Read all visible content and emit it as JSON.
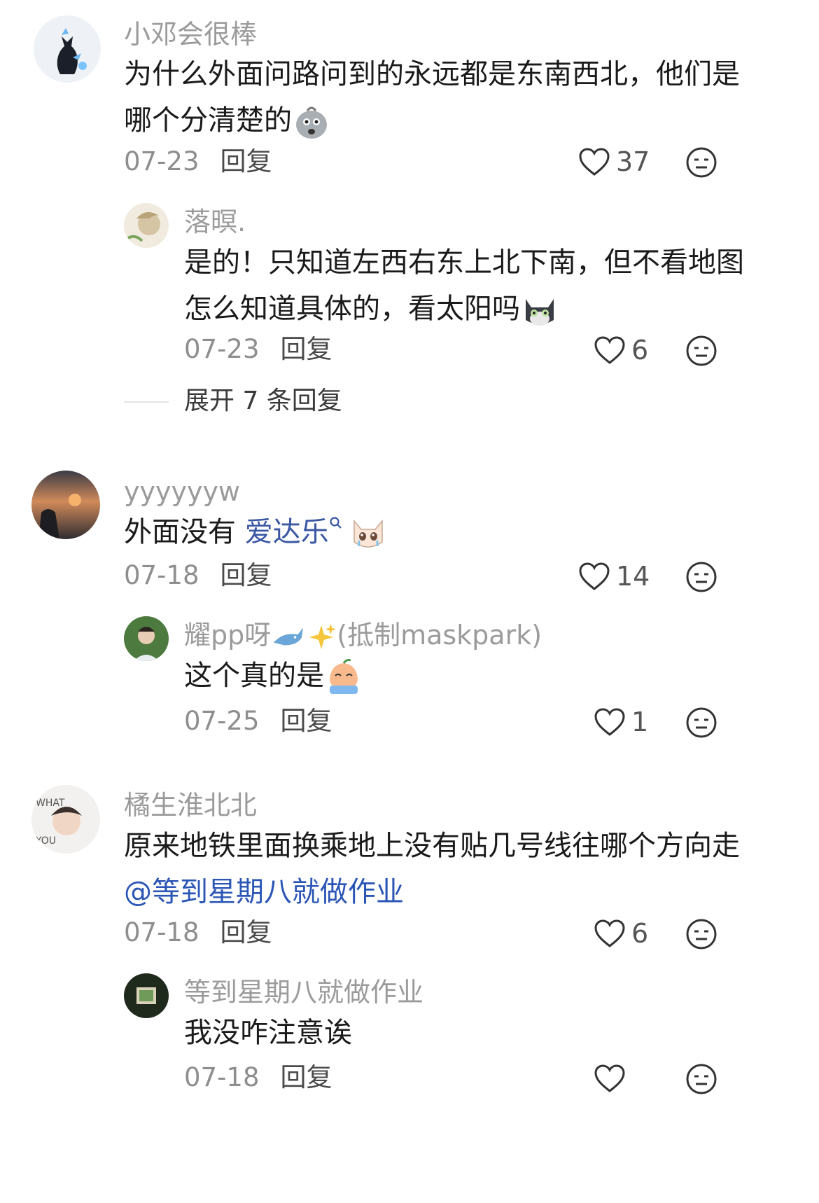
{
  "comments": [
    {
      "username": "小邓会很棒",
      "text_line1": "为什么外面问路问到的永远都是东南西北，他们是",
      "text_line2": "哪个分清楚的",
      "emoji": "shocked-face-emoji",
      "date": "07-23",
      "reply_label": "回复",
      "likes": "37",
      "replies": [
        {
          "username": "落暝.",
          "text_line1": "是的！只知道左西右东上北下南，但不看地图",
          "text_line2": "怎么知道具体的，看太阳吗",
          "emoji": "cat-face-emoji",
          "date": "07-23",
          "reply_label": "回复",
          "likes": "6"
        }
      ],
      "expand_label": "展开 7 条回复"
    },
    {
      "username": "yyyyyyw",
      "text_prefix": "外面没有 ",
      "link_text": "爱达乐",
      "emoji": "crying-cat-emoji",
      "date": "07-18",
      "reply_label": "回复",
      "likes": "14",
      "replies": [
        {
          "username_main": "耀pp呀",
          "username_suffix": "(抵制maskpark)",
          "text": "这个真的是",
          "emoji": "crying-peach-emoji",
          "date": "07-25",
          "reply_label": "回复",
          "likes": "1"
        }
      ]
    },
    {
      "username": "橘生淮北北",
      "text_line1": "原来地铁里面换乘地上没有贴几号线往哪个方向走",
      "mention": "@等到星期八就做作业",
      "date": "07-18",
      "reply_label": "回复",
      "likes": "6",
      "replies": [
        {
          "username": "等到星期八就做作业",
          "text": "我没咋注意诶",
          "date": "07-18",
          "reply_label": "回复",
          "likes": ""
        }
      ]
    }
  ],
  "colors": {
    "username": "#9b9b9b",
    "text": "#1a1a1a",
    "link": "#3a57a4",
    "mention": "#2b56b5"
  }
}
